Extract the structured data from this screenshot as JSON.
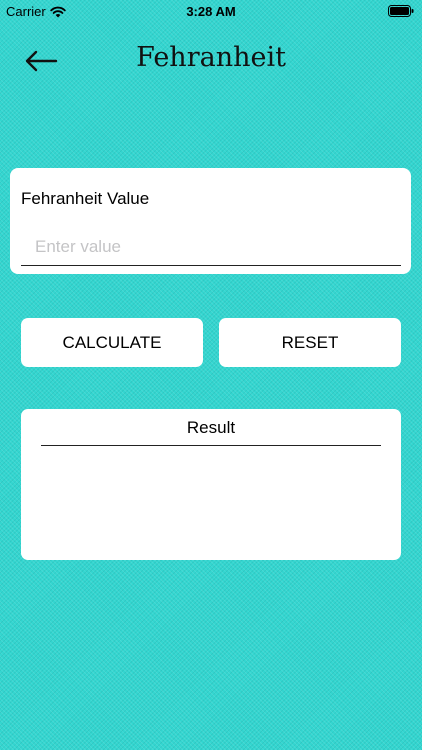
{
  "status_bar": {
    "carrier": "Carrier",
    "time": "3:28 AM",
    "icons": [
      "wifi-icon",
      "battery-icon"
    ]
  },
  "nav": {
    "title": "Fehranheit",
    "back_icon": "arrow-left-icon"
  },
  "input": {
    "label": "Fehranheit Value",
    "placeholder": "Enter value",
    "value": ""
  },
  "buttons": {
    "calculate_label": "CALCULATE",
    "reset_label": "RESET"
  },
  "result": {
    "title": "Result",
    "value": ""
  },
  "colors": {
    "background": "#33d6d0",
    "card": "#ffffff",
    "text": "#000000",
    "placeholder": "#c4c4c6"
  }
}
